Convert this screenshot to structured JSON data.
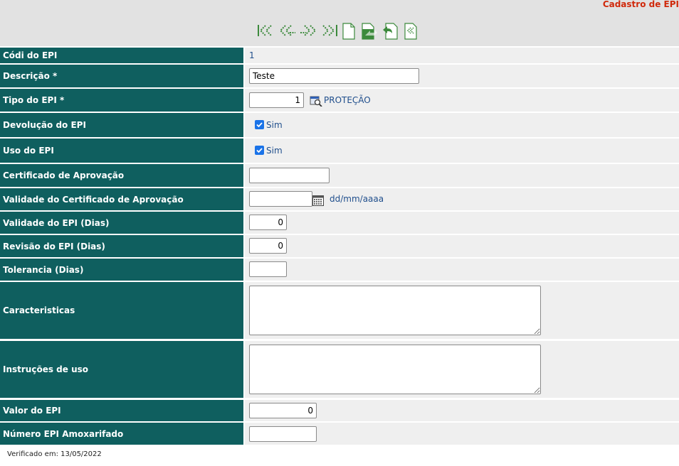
{
  "header": {
    "title": "Cadastro de EPI"
  },
  "toolbar": {
    "icons": [
      "first-record-icon",
      "previous-record-icon",
      "next-record-icon",
      "last-record-icon",
      "new-record-icon",
      "save-record-icon",
      "undo-icon",
      "back-to-list-icon"
    ]
  },
  "fields": {
    "codigo": {
      "label": "Códi do EPI",
      "value": "1"
    },
    "descricao": {
      "label": "Descrição *",
      "value": "Teste"
    },
    "tipo": {
      "label": "Tipo do EPI *",
      "value": "1",
      "description": "PROTEÇÃO"
    },
    "devolucao": {
      "label": "Devolução do EPI",
      "checkbox_label": "Sim",
      "checked": true
    },
    "uso": {
      "label": "Uso do EPI",
      "checkbox_label": "Sim",
      "checked": true
    },
    "certificado": {
      "label": "Certificado de Aprovação",
      "value": ""
    },
    "validade_certificado": {
      "label": "Validade do Certificado de Aprovação",
      "value": "",
      "format_hint": "dd/mm/aaaa"
    },
    "validade_epi": {
      "label": "Validade do EPI (Dias)",
      "value": "0"
    },
    "revisao_epi": {
      "label": "Revisão do EPI (Dias)",
      "value": "0"
    },
    "tolerancia": {
      "label": "Tolerancia (Dias)",
      "value": ""
    },
    "caracteristicas": {
      "label": "Caracteristicas",
      "value": ""
    },
    "instrucoes": {
      "label": "Instruções de uso",
      "value": ""
    },
    "valor": {
      "label": "Valor do EPI",
      "value": "0"
    },
    "numero_amoxarifado": {
      "label": "Número EPI Amoxarifado",
      "value": ""
    }
  },
  "footer": {
    "text": "Verificado em: 13/05/2022"
  },
  "colors": {
    "label_bg": "#0f5f5f",
    "title": "#d0290b",
    "link": "#1f4e8c"
  }
}
